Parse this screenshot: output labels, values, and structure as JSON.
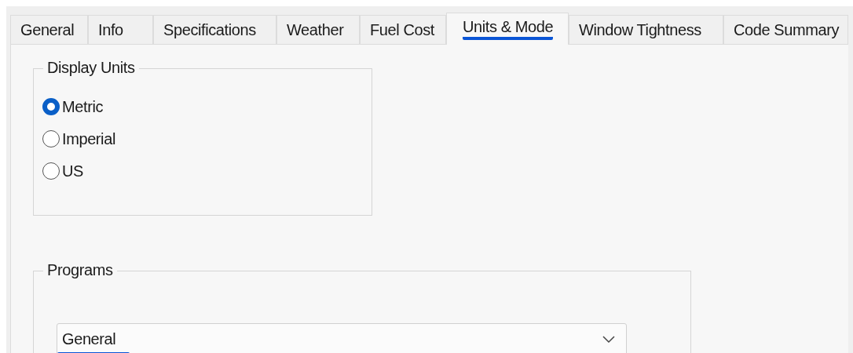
{
  "tabs": [
    {
      "label": "General",
      "selected": false
    },
    {
      "label": "Info",
      "selected": false
    },
    {
      "label": "Specifications",
      "selected": false
    },
    {
      "label": "Weather",
      "selected": false
    },
    {
      "label": "Fuel Cost",
      "selected": false
    },
    {
      "label": "Units & Mode",
      "selected": true
    },
    {
      "label": "Window Tightness",
      "selected": false
    },
    {
      "label": "Code Summary",
      "selected": false
    }
  ],
  "display_units": {
    "title": "Display Units",
    "options": [
      {
        "label": "Metric",
        "selected": true
      },
      {
        "label": "Imperial",
        "selected": false
      },
      {
        "label": "US",
        "selected": false
      }
    ]
  },
  "programs": {
    "title": "Programs",
    "value": "General",
    "focused": true
  }
}
